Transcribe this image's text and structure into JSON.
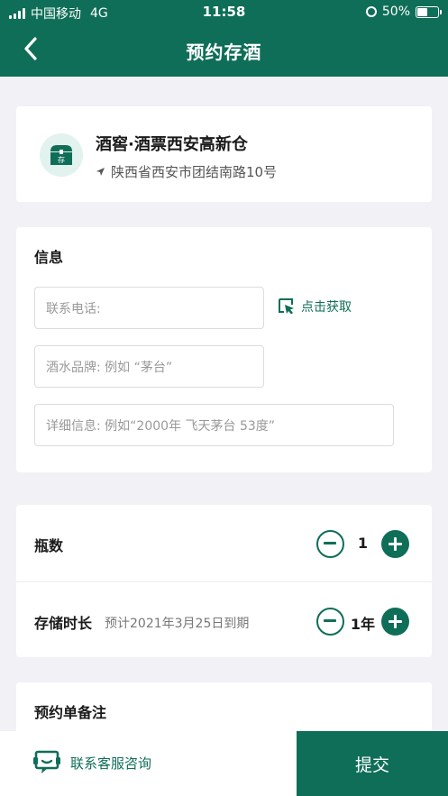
{
  "status_bar": {
    "carrier": "中国移动",
    "network": "4G",
    "time": "11:58",
    "battery": "50%",
    "battery_level": 0.5
  },
  "header": {
    "title": "预约存酒",
    "back_icon": "chevron-left-icon"
  },
  "store": {
    "logo_char": "存",
    "name": "酒窖·酒票西安高新仓",
    "address": "陕西省西安市团结南路10号"
  },
  "info": {
    "title": "信息",
    "phone_placeholder": "联系电话:",
    "fetch_label": "点击获取",
    "brand_placeholder": "酒水品牌: 例如 “茅台”",
    "detail_placeholder": "详细信息: 例如“2000年 飞天茅台 53度”"
  },
  "quantity": {
    "bottles_label": "瓶数",
    "bottles_value": "1",
    "duration_label": "存储时长",
    "duration_hint": "预计2021年3月25日到期",
    "duration_value": "1年"
  },
  "note": {
    "title": "预约单备注"
  },
  "footer": {
    "service_label": "联系客服咨询",
    "submit_label": "提交"
  },
  "colors": {
    "primary": "#0f6e58",
    "background": "#f2f2f6"
  }
}
